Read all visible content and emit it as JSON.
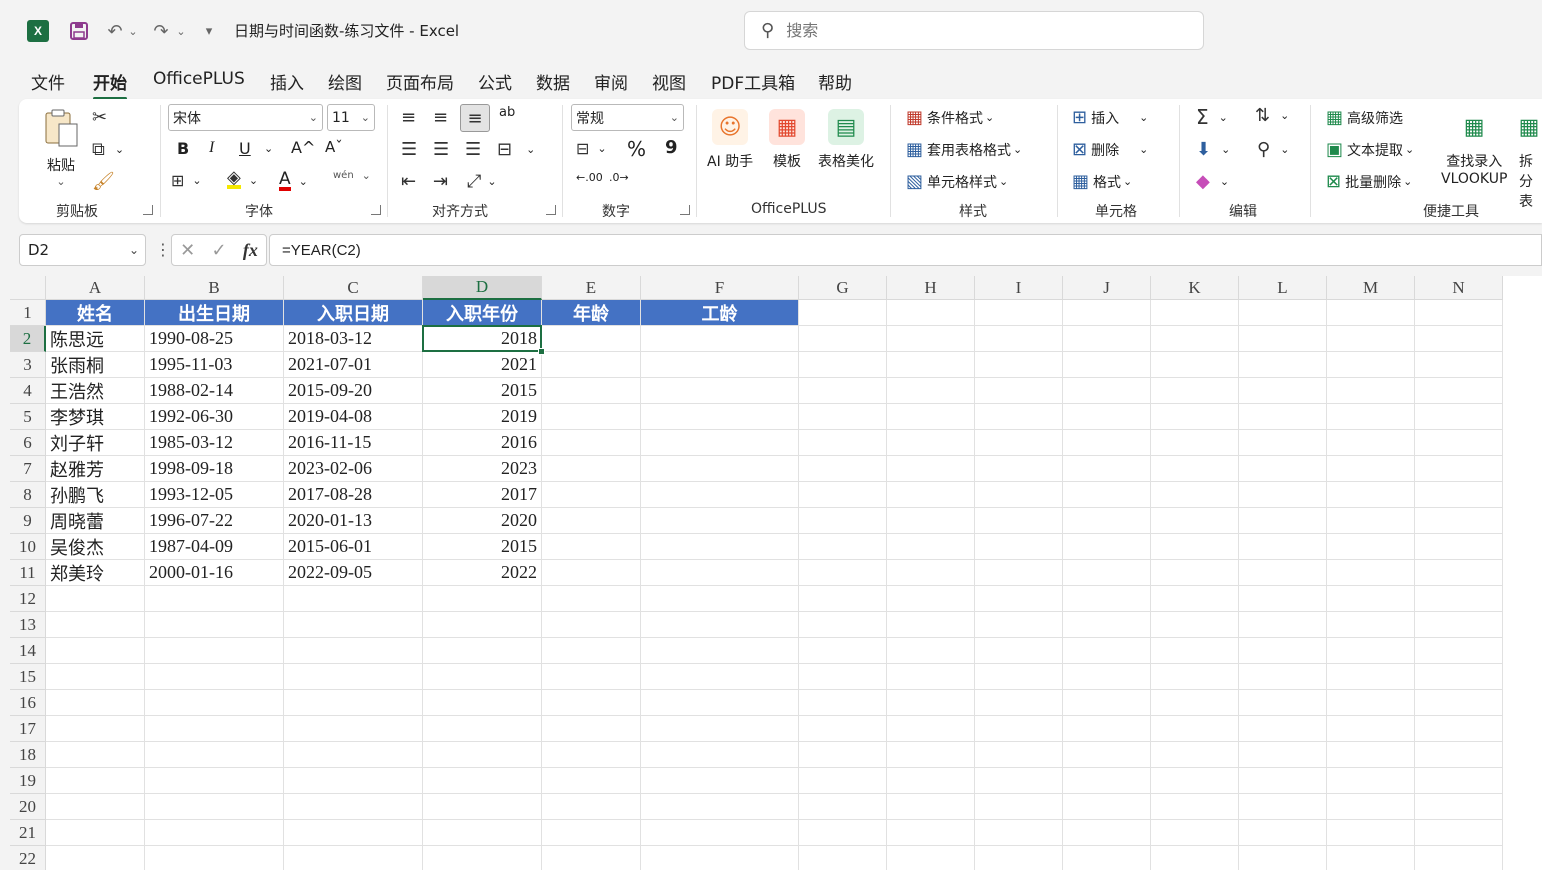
{
  "titlebar": {
    "logo_text": "X",
    "doc_title": "日期与时间函数-练习文件  -  Excel",
    "search_placeholder": "搜索",
    "search_icon": "search-icon"
  },
  "menu": [
    "文件",
    "开始",
    "OfficePLUS",
    "插入",
    "绘图",
    "页面布局",
    "公式",
    "数据",
    "审阅",
    "视图",
    "PDF工具箱",
    "帮助"
  ],
  "menu_active": "开始",
  "ribbon": {
    "clipboard": {
      "label": "剪贴板",
      "paste": "粘贴"
    },
    "font": {
      "label": "字体",
      "name": "宋体",
      "size": "11",
      "bold": "B",
      "italic": "I",
      "underline": "U",
      "grow": "A^",
      "shrink": "Aˇ",
      "wen": "wén"
    },
    "alignment": {
      "label": "对齐方式",
      "wrap": "ab"
    },
    "number": {
      "label": "数字",
      "format": "常规",
      "percent": "%",
      "comma": "9",
      "inc": ".00",
      "dec": ".0"
    },
    "officeplus": {
      "label": "OfficePLUS",
      "ai": "AI 助手",
      "template": "模板",
      "beautify": "表格美化"
    },
    "styles": {
      "label": "样式",
      "conditional": "条件格式",
      "table_format": "套用表格格式",
      "cell_style": "单元格样式"
    },
    "cells": {
      "label": "单元格",
      "insert": "插入",
      "delete": "删除",
      "format": "格式"
    },
    "editing": {
      "label": "编辑"
    },
    "quick": {
      "label": "便捷工具",
      "adv_filter": "高级筛选",
      "text_extract": "文本提取",
      "batch_delete": "批量删除",
      "lookup_line1": "查找录入",
      "lookup_line2": "VLOOKUP",
      "split": "拆分",
      "split2": "表"
    }
  },
  "formula_bar": {
    "name_box": "D2",
    "fx": "fx",
    "formula": "=YEAR(C2)"
  },
  "sheet": {
    "columns": [
      "A",
      "B",
      "C",
      "D",
      "E",
      "F",
      "G",
      "H",
      "I",
      "J",
      "K",
      "L",
      "M",
      "N"
    ],
    "rows": [
      "1",
      "2",
      "3",
      "4",
      "5",
      "6",
      "7",
      "8",
      "9",
      "10",
      "11",
      "12",
      "13",
      "14",
      "15",
      "16",
      "17",
      "18",
      "19",
      "20",
      "21",
      "22"
    ],
    "header": [
      "姓名",
      "出生日期",
      "入职日期",
      "入职年份",
      "年龄",
      "工龄"
    ],
    "data": [
      [
        "陈思远",
        "1990-08-25",
        "2018-03-12",
        "2018"
      ],
      [
        "张雨桐",
        "1995-11-03",
        "2021-07-01",
        "2021"
      ],
      [
        "王浩然",
        "1988-02-14",
        "2015-09-20",
        "2015"
      ],
      [
        "李梦琪",
        "1992-06-30",
        "2019-04-08",
        "2019"
      ],
      [
        "刘子轩",
        "1985-03-12",
        "2016-11-15",
        "2016"
      ],
      [
        "赵雅芳",
        "1998-09-18",
        "2023-02-06",
        "2023"
      ],
      [
        "孙鹏飞",
        "1993-12-05",
        "2017-08-28",
        "2017"
      ],
      [
        "周晓蕾",
        "1996-07-22",
        "2020-01-13",
        "2020"
      ],
      [
        "吴俊杰",
        "1987-04-09",
        "2015-06-01",
        "2015"
      ],
      [
        "郑美玲",
        "2000-01-16",
        "2022-09-05",
        "2022"
      ]
    ],
    "active_cell": "D2",
    "header_color": "#4472c4",
    "accent_color": "#1d6f42"
  }
}
